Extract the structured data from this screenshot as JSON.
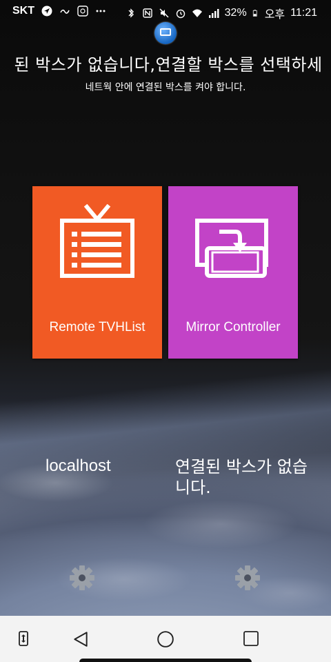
{
  "status_bar": {
    "carrier": "SKT",
    "battery": "32%",
    "ampm": "오후",
    "time": "11:21",
    "icons": [
      "navigation-icon",
      "lg-icon",
      "app-icon",
      "more-icon",
      "bluetooth-icon",
      "nfc-icon",
      "mute-icon",
      "alarm-icon",
      "wifi-icon",
      "signal-icon",
      "battery-icon"
    ]
  },
  "header": {
    "title": "된 박스가 없습니다,연결할 박스를 선택하세",
    "subtitle": "네트웍 안에 연결된 박스를 켜야 합니다."
  },
  "tiles": [
    {
      "label": "Remote TVHList",
      "color": "#f15a24",
      "icon": "tv-list-icon"
    },
    {
      "label": "Mirror Controller",
      "color": "#c243c7",
      "icon": "mirror-icon"
    }
  ],
  "hosts": {
    "left": "localhost",
    "right": "연결된 박스가 없습니다."
  },
  "nav": {
    "icons": [
      "rotate-icon",
      "back-icon",
      "home-icon",
      "recents-icon"
    ]
  }
}
